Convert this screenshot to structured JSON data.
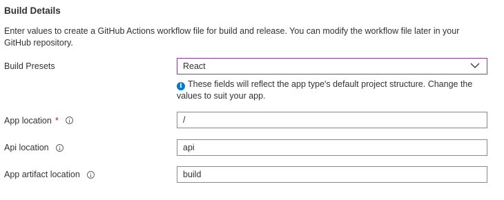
{
  "section": {
    "title": "Build Details",
    "description": "Enter values to create a GitHub Actions workflow file for build and release. You can modify the workflow file later in your GitHub repository."
  },
  "build_presets": {
    "label": "Build Presets",
    "selected": "React",
    "hint": "These fields will reflect the app type's default project structure. Change the values to suit your app."
  },
  "app_location": {
    "label": "App location",
    "required_mark": "*",
    "value": "/"
  },
  "api_location": {
    "label": "Api location",
    "value": "api"
  },
  "artifact_location": {
    "label": "App artifact location",
    "value": "build"
  },
  "colors": {
    "accent": "#0078d4",
    "focus_border": "#8a3b9a",
    "required": "#a4262c"
  },
  "icons": {
    "info": "info-icon",
    "chevron": "chevron-down-icon",
    "hint": "info-filled-icon"
  }
}
